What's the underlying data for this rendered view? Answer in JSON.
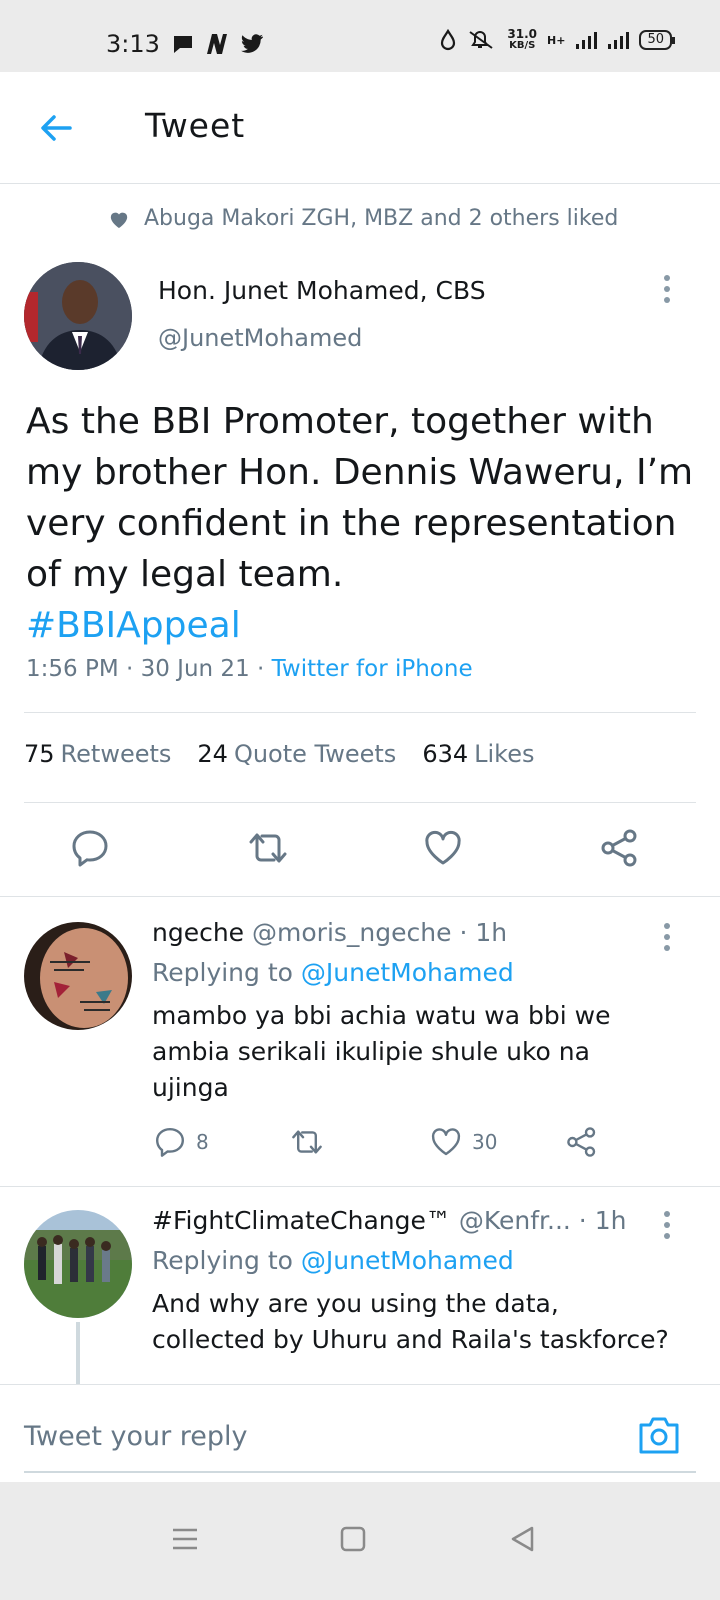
{
  "status_bar": {
    "time": "3:13",
    "speed_value": "31.0",
    "speed_unit": "KB/S",
    "network": "H+",
    "battery": "50"
  },
  "header": {
    "title": "Tweet"
  },
  "social_context": {
    "text": "Abuga Makori ZGH, MBZ and 2 others liked"
  },
  "tweet": {
    "author_name": "Hon. Junet Mohamed, CBS",
    "author_handle": "@JunetMohamed",
    "text": "As the BBI Promoter, together with my brother Hon. Dennis Waweru, I’m very confident in the representation of my legal team.",
    "hashtag": "#BBIAppeal",
    "time": "1:56 PM · 30 Jun 21 ·",
    "source": "Twitter for iPhone",
    "stats": {
      "retweets_count": "75",
      "retweets_label": "Retweets",
      "quotes_count": "24",
      "quotes_label": "Quote Tweets",
      "likes_count": "634",
      "likes_label": "Likes"
    }
  },
  "replies": [
    {
      "name": "ngeche",
      "handle": "@moris_ngeche",
      "time": "· 1h",
      "replying_prefix": "Replying to",
      "replying_to": "@JunetMohamed",
      "text": "mambo ya bbi achia watu wa bbi we ambia serikali ikulipie shule uko na ujinga",
      "reply_count": "8",
      "like_count": "30"
    },
    {
      "name": "#FightClimateChange™",
      "handle": "@Kenfr...",
      "time": "· 1h",
      "replying_prefix": "Replying to",
      "replying_to": "@JunetMohamed",
      "text": "And why are you using the data, collected by Uhuru and Raila's taskforce?"
    }
  ],
  "reply_bar": {
    "placeholder": "Tweet your reply"
  },
  "colors": {
    "accent": "#1da1f2",
    "secondary_text": "#667786",
    "divider": "#dfe3e6"
  }
}
